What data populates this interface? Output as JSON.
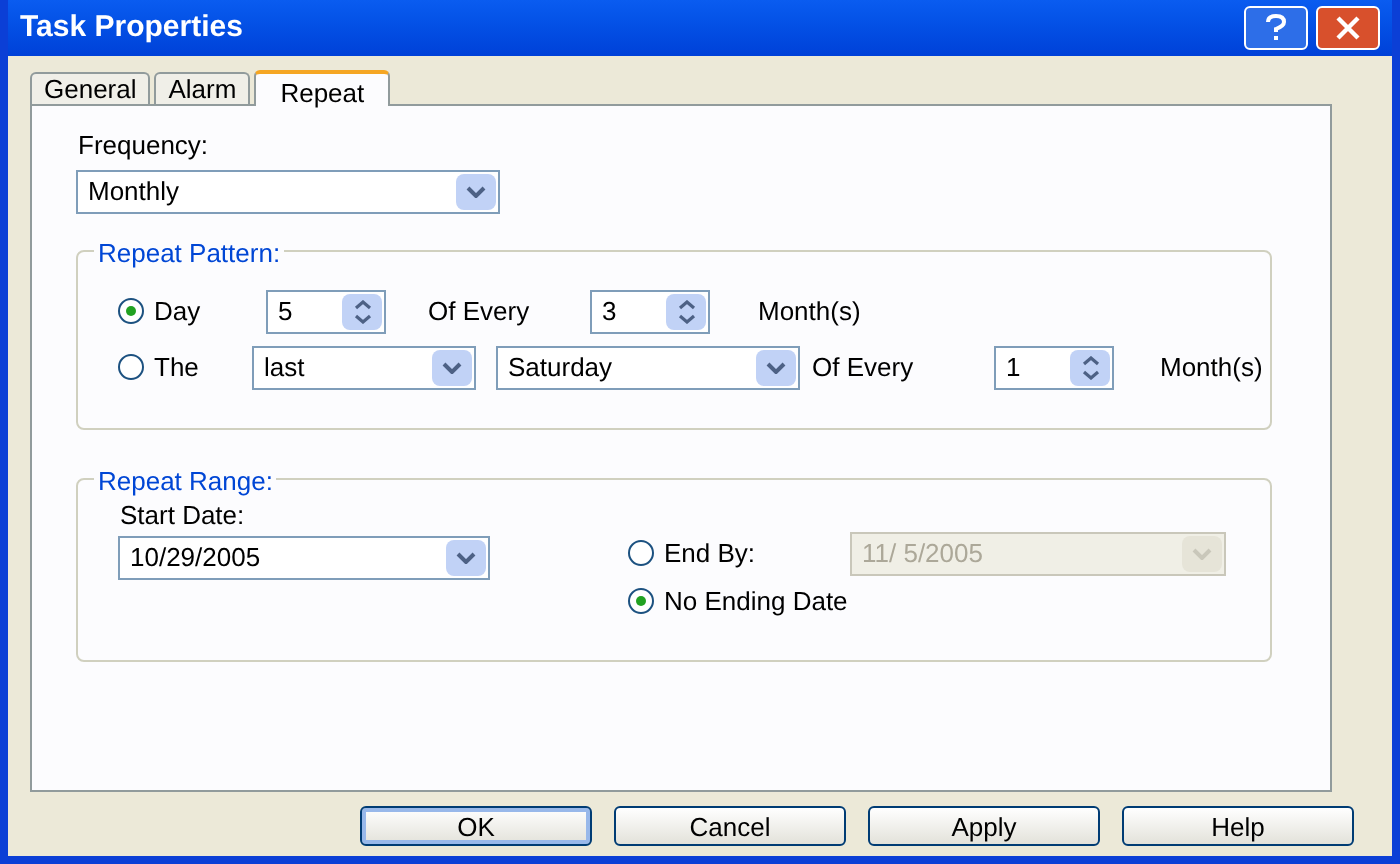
{
  "window": {
    "title": "Task Properties"
  },
  "tabs": [
    {
      "label": "General",
      "selected": false
    },
    {
      "label": "Alarm",
      "selected": false
    },
    {
      "label": "Repeat",
      "selected": true
    }
  ],
  "frequency": {
    "label": "Frequency:",
    "value": "Monthly"
  },
  "repeat_pattern": {
    "title": "Repeat Pattern:",
    "day_option": {
      "label": "Day",
      "selected": true,
      "day": "5",
      "of_every": "Of Every",
      "months": "3",
      "unit": "Month(s)"
    },
    "the_option": {
      "label": "The",
      "selected": false,
      "ordinal": "last",
      "weekday": "Saturday",
      "of_every": "Of Every",
      "months": "1",
      "unit": "Month(s)"
    }
  },
  "repeat_range": {
    "title": "Repeat Range:",
    "start_date": {
      "label": "Start Date:",
      "value": "10/29/2005"
    },
    "end_by": {
      "label": "End By:",
      "selected": false,
      "value": "11/ 5/2005",
      "disabled": true
    },
    "no_ending_date": {
      "label": "No Ending Date",
      "selected": true
    }
  },
  "buttons": [
    {
      "label": "OK",
      "default": true
    },
    {
      "label": "Cancel",
      "default": false
    },
    {
      "label": "Apply",
      "default": false
    },
    {
      "label": "Help",
      "default": false
    }
  ]
}
